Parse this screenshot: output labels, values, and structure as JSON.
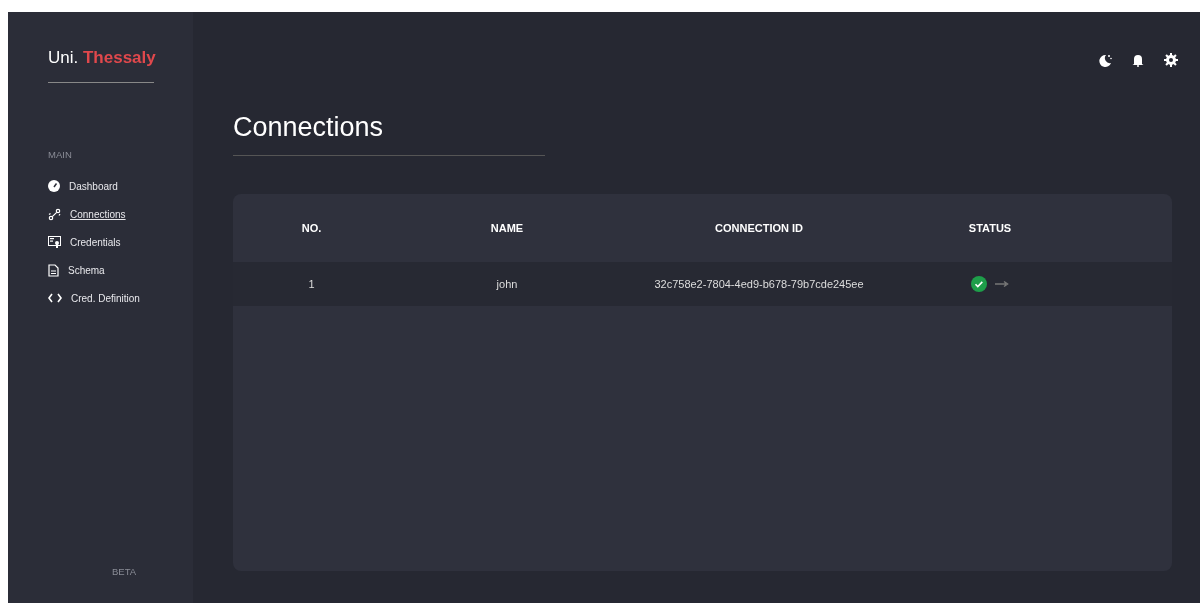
{
  "brand": {
    "prefix": "Uni.",
    "name": "Thessaly"
  },
  "sidebar": {
    "section": "MAIN",
    "items": [
      {
        "label": "Dashboard",
        "selected": false
      },
      {
        "label": "Connections",
        "selected": true
      },
      {
        "label": "Credentials",
        "selected": false
      },
      {
        "label": "Schema",
        "selected": false
      },
      {
        "label": "Cred. Definition",
        "selected": false
      }
    ],
    "footer": "BETA"
  },
  "page": {
    "title": "Connections"
  },
  "table": {
    "columns": [
      "NO.",
      "NAME",
      "CONNECTION ID",
      "STATUS"
    ],
    "rows": [
      {
        "no": "1",
        "name": "john",
        "connection_id": "32c758e2-7804-4ed9-b678-79b7cde245ee",
        "active": true
      }
    ]
  }
}
